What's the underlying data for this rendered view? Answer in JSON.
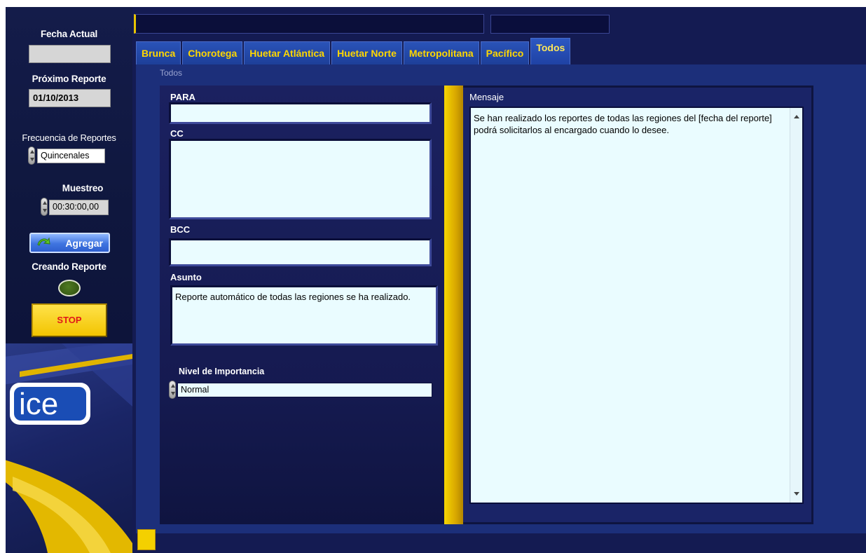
{
  "sidebar": {
    "fecha_actual_label": "Fecha Actual",
    "fecha_actual_value": "",
    "proximo_reporte_label": "Próximo Reporte",
    "proximo_reporte_value": "01/10/2013",
    "frecuencia_label": "Frecuencia de Reportes",
    "frecuencia_value": "Quincenales",
    "muestreo_label": "Muestreo",
    "muestreo_value": "00:30:00,00",
    "agregar_label": "Agregar",
    "creando_reporte_label": "Creando Reporte",
    "stop_label": "STOP",
    "logo_text": "ice"
  },
  "tabs": [
    {
      "label": "Brunca"
    },
    {
      "label": "Chorotega"
    },
    {
      "label": "Huetar Atlántica"
    },
    {
      "label": "Huetar Norte"
    },
    {
      "label": "Metropolitana"
    },
    {
      "label": "Pacífico"
    },
    {
      "label": "Todos"
    }
  ],
  "active_tab": "Todos",
  "page": {
    "title": "Todos",
    "para_label": "PARA",
    "para_value": "",
    "cc_label": "CC",
    "cc_value": "",
    "bcc_label": "BCC",
    "bcc_value": "",
    "asunto_label": "Asunto",
    "asunto_value": "Reporte automático de todas las regiones se ha realizado.",
    "nivel_label": "Nivel de Importancia",
    "nivel_value": "Normal",
    "mensaje_label": "Mensaje",
    "mensaje_value": "Se han realizado los reportes de todas las regiones del [fecha del reporte] podrá solicitarlos al encargado cuando lo desee."
  },
  "colors": {
    "panel_dark": "#141b52",
    "tab_text": "#ffd700",
    "tab_bg": "#1f42a4",
    "input_bg": "#eafcff",
    "accent_yellow": "#f2c400",
    "stop_text": "#e01818",
    "led_green": "#3e6619"
  },
  "icons": [
    "spinner-icon",
    "green-arrow-icon",
    "led-indicator-icon",
    "ice-logo",
    "scroll-up-icon",
    "scroll-down-icon"
  ]
}
